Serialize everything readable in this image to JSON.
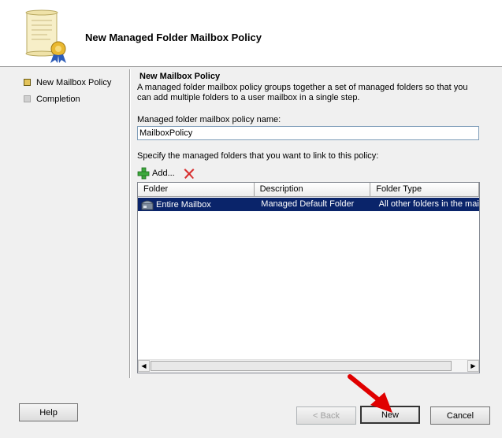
{
  "header": {
    "title": "New Managed Folder Mailbox Policy"
  },
  "steps": [
    {
      "label": "New Mailbox Policy",
      "state": "active"
    },
    {
      "label": "Completion",
      "state": "inactive"
    }
  ],
  "page": {
    "title": "New Mailbox Policy",
    "description": "A managed folder mailbox policy groups together a set of managed folders so that you can add multiple folders to a user mailbox in a single step.",
    "name_label": "Managed folder mailbox policy name:",
    "name_value": "MailboxPolicy",
    "list_label": "Specify the managed folders that you want to link to this policy:"
  },
  "toolbar": {
    "add_label": "Add...",
    "add_icon": "plus-icon",
    "delete_icon": "delete-x-icon"
  },
  "list": {
    "columns": [
      "Folder",
      "Description",
      "Folder Type"
    ],
    "rows": [
      {
        "folder": "Entire Mailbox",
        "description": "Managed Default Folder",
        "type": "All other folders in the mailbox",
        "selected": true
      }
    ]
  },
  "buttons": {
    "help": "Help",
    "back": "< Back",
    "next": "New",
    "cancel": "Cancel"
  },
  "colors": {
    "selection": "#0a246a",
    "arrow": "#e00000"
  }
}
